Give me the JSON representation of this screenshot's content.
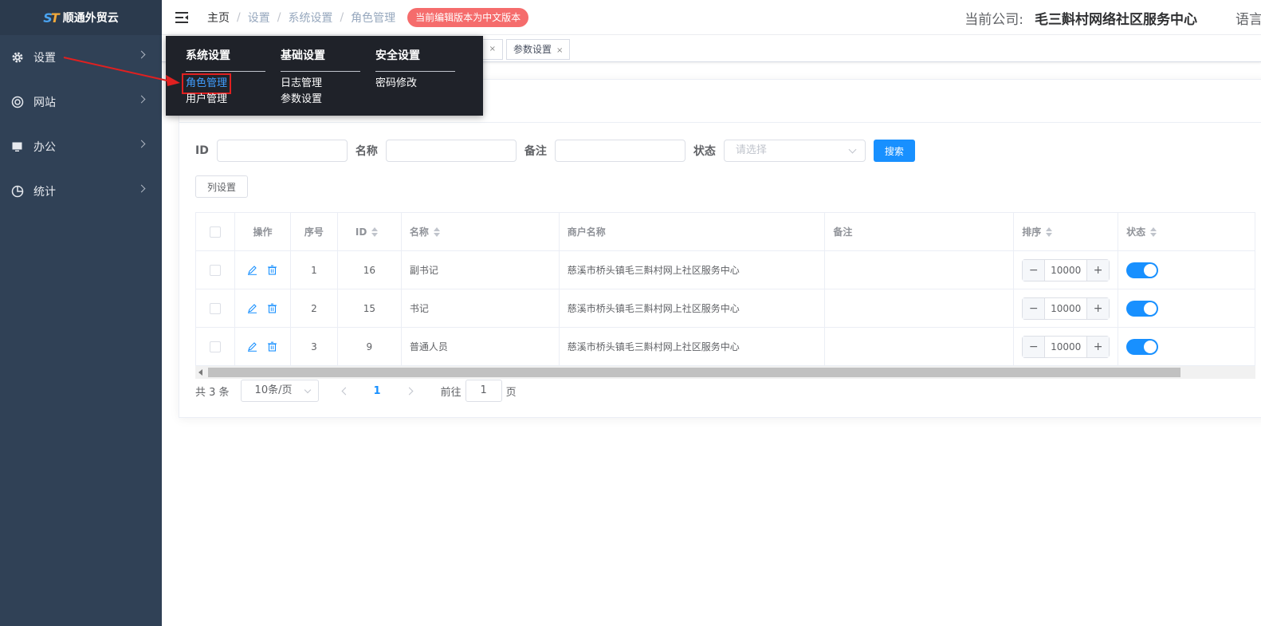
{
  "app": {
    "logo_text": "顺通外贸云"
  },
  "sidebar": {
    "items": [
      {
        "label": "设置",
        "icon": "gear-icon"
      },
      {
        "label": "网站",
        "icon": "lifebuoy-icon"
      },
      {
        "label": "办公",
        "icon": "monitor-icon"
      },
      {
        "label": "统计",
        "icon": "pie-chart-icon"
      }
    ]
  },
  "header": {
    "breadcrumb": [
      "主页",
      "设置",
      "系统设置",
      "角色管理"
    ],
    "version_badge": "当前编辑版本为中文版本",
    "company_label": "当前公司:",
    "company_name": "毛三斢村网络社区服务中心",
    "language_label": "语言"
  },
  "tags": [
    {
      "label": "参数设置"
    }
  ],
  "mega_menu": {
    "columns": [
      {
        "heading": "系统设置",
        "items": [
          "角色管理",
          "用户管理"
        ]
      },
      {
        "heading": "基础设置",
        "items": [
          "日志管理",
          "参数设置"
        ]
      },
      {
        "heading": "安全设置",
        "items": [
          "密码修改"
        ]
      }
    ],
    "highlight_color": "#409eff",
    "annotation_color": "#e02020"
  },
  "search": {
    "id_label": "ID",
    "name_label": "名称",
    "remark_label": "备注",
    "status_label": "状态",
    "status_placeholder": "请选择",
    "search_button": "搜索",
    "column_settings_button": "列设置"
  },
  "table": {
    "headers": [
      "操作",
      "序号",
      "ID",
      "名称",
      "商户名称",
      "备注",
      "排序",
      "状态"
    ],
    "rows": [
      {
        "index": "1",
        "id": "16",
        "name": "副书记",
        "merchant": "慈溪市桥头镇毛三斢村网上社区服务中心",
        "remark": "",
        "sort": "10000",
        "status": true
      },
      {
        "index": "2",
        "id": "15",
        "name": "书记",
        "merchant": "慈溪市桥头镇毛三斢村网上社区服务中心",
        "remark": "",
        "sort": "10000",
        "status": true
      },
      {
        "index": "3",
        "id": "9",
        "name": "普通人员",
        "merchant": "慈溪市桥头镇毛三斢村网上社区服务中心",
        "remark": "",
        "sort": "10000",
        "status": true
      }
    ]
  },
  "pagination": {
    "total_text": "共 3 条",
    "page_size": "10条/页",
    "current_page": "1",
    "goto_label": "前往",
    "goto_value": "1",
    "page_suffix": "页"
  },
  "colors": {
    "sidebar_bg": "#304156",
    "primary": "#1890ff",
    "badge_red": "#f56c6c"
  }
}
